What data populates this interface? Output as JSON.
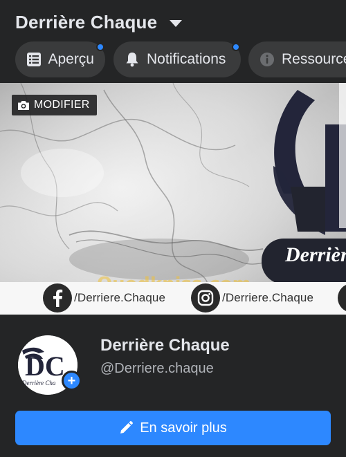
{
  "header": {
    "title": "Derrière Chaque"
  },
  "tabs": [
    {
      "label": "Aperçu",
      "icon": "list-icon",
      "has_dot": true
    },
    {
      "label": "Notifications",
      "icon": "bell-icon",
      "has_dot": true
    },
    {
      "label": "Ressources",
      "icon": "info-icon",
      "has_dot": false
    }
  ],
  "cover": {
    "edit_label": "MODIFIER",
    "watermark": "Ouedkniss.com",
    "logo_text": "Derrière",
    "social": [
      {
        "icon": "facebook-icon",
        "handle": "/Derriere.Chaque"
      },
      {
        "icon": "instagram-icon",
        "handle": "/Derriere.Chaque"
      }
    ]
  },
  "profile": {
    "name": "Derrière Chaque",
    "handle": "@Derriere.chaque",
    "avatar_text": "DC",
    "avatar_caption": "Derrière Cha",
    "cta_label": "En savoir plus"
  },
  "colors": {
    "background": "#242526",
    "accent": "#2d88ff",
    "tab_bg": "#3a3b3c"
  }
}
